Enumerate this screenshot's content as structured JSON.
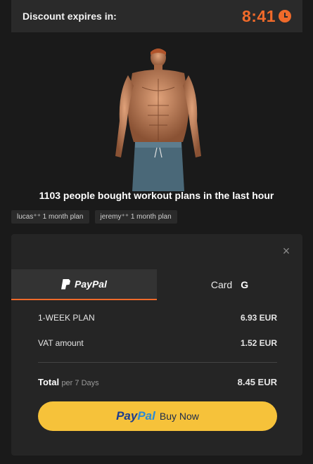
{
  "timer": {
    "label": "Discount expires in:",
    "value": "8:41",
    "icon": "clock-icon"
  },
  "hero": {
    "headline": "1103 people bought workout plans in the last hour"
  },
  "badges": [
    {
      "text": "lucas⁺⁺ 1 month plan"
    },
    {
      "text": "jeremy⁺⁺ 1 month plan"
    }
  ],
  "checkout": {
    "close": "×",
    "tabs": [
      {
        "label": "PayPal",
        "active": true
      },
      {
        "label": "Card",
        "icons": [
          "apple-icon",
          "google-icon"
        ],
        "apple": "",
        "google": "G"
      }
    ],
    "lines": [
      {
        "label": "1-WEEK PLAN",
        "amount": "6.93 EUR"
      },
      {
        "label": "VAT amount",
        "amount": "1.52 EUR"
      }
    ],
    "total": {
      "label": "Total",
      "sub": "per 7 Days",
      "amount": "8.45 EUR"
    },
    "buy_button": {
      "brand_1": "Pay",
      "brand_2": "Pal",
      "label": "Buy Now"
    }
  },
  "colors": {
    "accent": "#f06a2a",
    "button": "#f6c23a",
    "background": "#1a1a1a",
    "panel": "#252525"
  }
}
